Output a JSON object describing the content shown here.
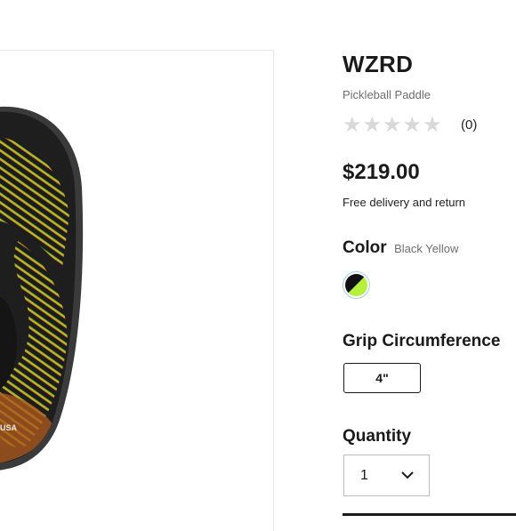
{
  "product": {
    "name": "WZRD",
    "category": "Pickleball Paddle",
    "rating_stars": 0,
    "review_count": "(0)",
    "price": "$219.00",
    "delivery_text": "Free delivery and return"
  },
  "color": {
    "label": "Color",
    "value": "Black Yellow",
    "swatch_colors": [
      "#111111",
      "#b5f03a"
    ]
  },
  "grip": {
    "label": "Grip Circumference",
    "options": [
      "4\""
    ]
  },
  "quantity": {
    "label": "Quantity",
    "value": "1"
  },
  "image": {
    "alt": "WZRD pickleball paddle",
    "logo_text": "USA"
  }
}
